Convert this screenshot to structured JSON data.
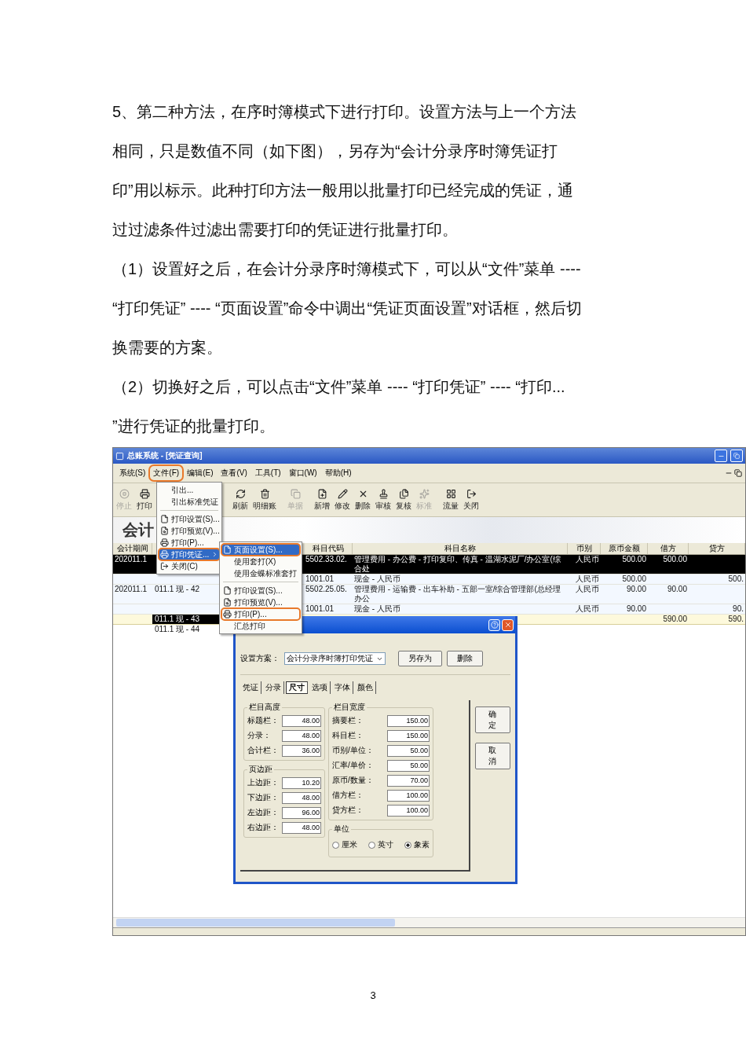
{
  "document": {
    "paragraphs": [
      "5、第二种方法，在序时簿模式下进行打印。设置方法与上一个方法相同，只是数值不同（如下图），另存为“会计分录序时簿凭证打印”用以标示。此种打印方法一般用以批量打印已经完成的凭证，通过过滤条件过滤出需要打印的凭证进行批量打印。",
      "（1）设置好之后，在会计分录序时簿模式下，可以从“文件”菜单 ---- “打印凭证” ---- “页面设置”命令中调出“凭证页面设置”对话框，然后切换需要的方案。",
      "（2）切换好之后，可以点击“文件”菜单 ---- “打印凭证” ---- “打印... ”进行凭证的批量打印。"
    ],
    "page_number": "3"
  },
  "window": {
    "title": "总账系统 - [凭证查询]"
  },
  "menubar": [
    {
      "label": "系统(S)",
      "highlighted": false
    },
    {
      "label": "文件(F)",
      "highlighted": true
    },
    {
      "label": "编辑(E)",
      "highlighted": false
    },
    {
      "label": "查看(V)",
      "highlighted": false
    },
    {
      "label": "工具(T)",
      "highlighted": false
    },
    {
      "label": "窗口(W)",
      "highlighted": false
    },
    {
      "label": "帮助(H)",
      "highlighted": false
    }
  ],
  "toolbar": [
    {
      "label": "停止",
      "disabled": true
    },
    {
      "label": "打印",
      "disabled": false
    },
    {
      "label": "刷新",
      "disabled": false
    },
    {
      "label": "明细账",
      "disabled": false
    },
    {
      "label": "单据",
      "disabled": true
    },
    {
      "label": "新增",
      "disabled": false
    },
    {
      "label": "修改",
      "disabled": false
    },
    {
      "label": "删除",
      "disabled": false
    },
    {
      "label": "审核",
      "disabled": false
    },
    {
      "label": "复核",
      "disabled": false
    },
    {
      "label": "标准",
      "disabled": true
    },
    {
      "label": "流量",
      "disabled": false
    },
    {
      "label": "关闭",
      "disabled": false
    }
  ],
  "banner": {
    "title": "会计"
  },
  "table": {
    "headers": {
      "period": "会计期间",
      "code": "科目代码",
      "name": "科目名称",
      "currency": "币别",
      "amount": "原币金额",
      "debit": "借方",
      "credit": "贷方"
    },
    "rows": [
      {
        "kind": "entry",
        "selected": true,
        "period": "202011.1",
        "code": "5502.33.02.",
        "name": "管理费用 - 办公费 - 打印复印、传真 - 温湖水泥厂/办公室(综合处",
        "currency": "人民币",
        "amount": "500.00",
        "debit": "500.00"
      },
      {
        "kind": "entry",
        "selected": false,
        "code": "1001.01",
        "name": "现金 - 人民币",
        "currency": "人民币",
        "amount": "500.00",
        "credit": "500."
      },
      {
        "kind": "entry",
        "selected": false,
        "voucher_selected": false,
        "period": "202011.1",
        "voucher": "011.1 现 - 42",
        "code": "5502.25.05.",
        "name": "管理费用 - 运输费 - 出车补助 - 五部一室/综合管理部(总经理办公",
        "currency": "人民币",
        "amount": "90.00",
        "debit": "90.00"
      },
      {
        "kind": "entry",
        "selected": false,
        "code": "1001.01",
        "name": "现金 - 人民币",
        "currency": "人民币",
        "amount": "90.00",
        "credit": "90."
      },
      {
        "kind": "total",
        "selected": false,
        "voucher_selected": true,
        "voucher": "011.1 现 - 43",
        "debit": "590.00",
        "credit": "590."
      },
      {
        "kind": "blank",
        "selected": false,
        "voucher_selected": false,
        "voucher": "011.1 现 - 44"
      }
    ]
  },
  "file_menu": [
    {
      "kind": "item",
      "label": "引出...",
      "selected": false,
      "highlighted": false
    },
    {
      "kind": "item",
      "label": "引出标准凭证",
      "selected": false,
      "highlighted": false
    },
    {
      "kind": "separator"
    },
    {
      "kind": "item",
      "label": "打印设置(S)...",
      "selected": false,
      "highlighted": false
    },
    {
      "kind": "item",
      "label": "打印预览(V)...",
      "selected": false,
      "highlighted": false
    },
    {
      "kind": "item",
      "label": "打印(P)...",
      "selected": false,
      "highlighted": false
    },
    {
      "kind": "submenu",
      "label": "打印凭证...",
      "selected": true,
      "highlighted": true
    },
    {
      "kind": "item",
      "label": "关闭(C)",
      "selected": false,
      "highlighted": false
    }
  ],
  "print_submenu": [
    {
      "kind": "item",
      "label": "页面设置(S)...",
      "selected": true,
      "highlighted": true
    },
    {
      "kind": "item",
      "label": "使用套打(X)",
      "selected": false,
      "highlighted": false
    },
    {
      "kind": "item",
      "label": "使用金蝶标准套打",
      "selected": false,
      "highlighted": false
    },
    {
      "kind": "separator"
    },
    {
      "kind": "item",
      "label": "打印设置(S)...",
      "selected": false,
      "highlighted": false
    },
    {
      "kind": "item",
      "label": "打印预览(V)...",
      "selected": false,
      "highlighted": false
    },
    {
      "kind": "item",
      "label": "打印(P)...",
      "selected": false,
      "highlighted": true
    },
    {
      "kind": "item",
      "label": "汇总打印",
      "selected": false,
      "highlighted": false
    }
  ],
  "dialog": {
    "scheme_label": "设置方案：",
    "scheme": "会计分录序时簿打印凭证",
    "buttons": [
      "另存为",
      "删除"
    ],
    "tabs": [
      {
        "label": "凭证",
        "selected": false
      },
      {
        "label": "分录",
        "selected": false
      },
      {
        "label": "尺寸",
        "selected": true
      },
      {
        "label": "选项",
        "selected": false
      },
      {
        "label": "字体",
        "selected": false
      },
      {
        "label": "颜色",
        "selected": false
      }
    ],
    "side_buttons": [
      "确定",
      "取消"
    ],
    "groups": [
      {
        "title": "栏目高度",
        "fields": [
          {
            "label": "标题栏：",
            "value": "48.00"
          },
          {
            "label": "分录：",
            "value": "48.00"
          },
          {
            "label": "合计栏：",
            "value": "36.00"
          }
        ]
      },
      {
        "title": "页边距",
        "fields": [
          {
            "label": "上边距：",
            "value": "10.20"
          },
          {
            "label": "下边距：",
            "value": "48.00"
          },
          {
            "label": "左边距：",
            "value": "96.00"
          },
          {
            "label": "右边距：",
            "value": "48.00"
          }
        ]
      },
      {
        "title": "栏目宽度",
        "fields": [
          {
            "label": "摘要栏：",
            "value": "150.00"
          },
          {
            "label": "科目栏：",
            "value": "150.00"
          },
          {
            "label": "币别/单位：",
            "value": "50.00"
          },
          {
            "label": "汇率/单价：",
            "value": "50.00"
          },
          {
            "label": "原币/数量：",
            "value": "70.00"
          },
          {
            "label": "借方栏：",
            "value": "100.00"
          },
          {
            "label": "贷方栏：",
            "value": "100.00"
          }
        ]
      }
    ],
    "units": {
      "title": "单位",
      "options": [
        {
          "label": "厘米",
          "selected": false
        },
        {
          "label": "英寸",
          "selected": false
        },
        {
          "label": "象素",
          "selected": true
        }
      ]
    }
  }
}
